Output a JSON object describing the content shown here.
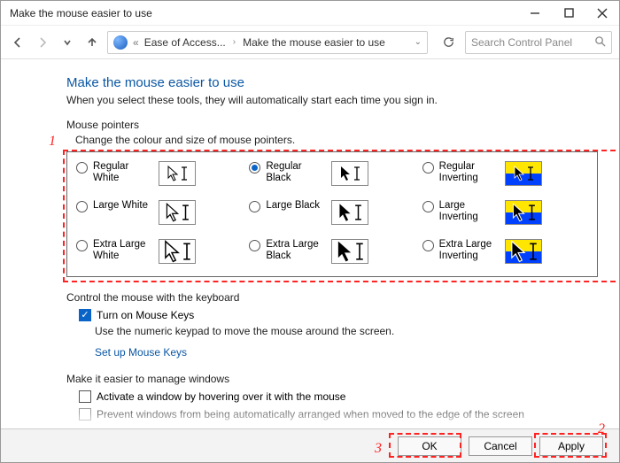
{
  "window": {
    "title": "Make the mouse easier to use"
  },
  "address": {
    "crumb1": "Ease of Access...",
    "crumb2": "Make the mouse easier to use"
  },
  "search": {
    "placeholder": "Search Control Panel"
  },
  "page": {
    "title": "Make the mouse easier to use",
    "subtitle": "When you select these tools, they will automatically start each time you sign in.",
    "pointers_heading": "Mouse pointers",
    "pointers_sub": "Change the colour and size of mouse pointers."
  },
  "pointer_options": {
    "regular_white": "Regular White",
    "regular_black": "Regular Black",
    "regular_inverting": "Regular Inverting",
    "large_white": "Large White",
    "large_black": "Large Black",
    "large_inverting": "Large Inverting",
    "xl_white": "Extra Large White",
    "xl_black": "Extra Large Black",
    "xl_inverting": "Extra Large Inverting",
    "selected": "regular_black"
  },
  "keyboard_section": {
    "heading": "Control the mouse with the keyboard",
    "turn_on_label": "Turn on Mouse Keys",
    "hint": "Use the numeric keypad to move the mouse around the screen.",
    "link": "Set up Mouse Keys"
  },
  "windows_section": {
    "heading": "Make it easier to manage windows",
    "activate_hover": "Activate a window by hovering over it with the mouse",
    "prevent_arrange": "Prevent windows from being automatically arranged when moved to the edge of the screen"
  },
  "footer": {
    "ok": "OK",
    "cancel": "Cancel",
    "apply": "Apply"
  },
  "annotations": {
    "n1": "1",
    "n2": "2",
    "n3": "3"
  }
}
